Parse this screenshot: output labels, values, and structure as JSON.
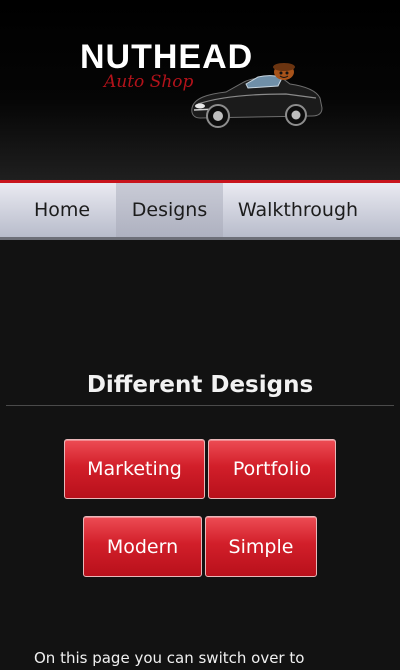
{
  "header": {
    "brand_title": "NUTHEAD",
    "brand_subtitle": "Auto Shop",
    "logo_image": "car-with-nut-mascot",
    "accent_color": "#c8141c"
  },
  "nav": {
    "items": [
      {
        "label": "Home"
      },
      {
        "label": "Designs",
        "active": true
      },
      {
        "label": "Walkthrough"
      }
    ]
  },
  "main": {
    "title": "Different Designs",
    "buttons": [
      {
        "label": "Marketing"
      },
      {
        "label": "Portfolio"
      },
      {
        "label": "Modern"
      },
      {
        "label": "Simple"
      }
    ],
    "intro_text": "On this page you can switch over to",
    "button_color": "#d21f2a"
  }
}
